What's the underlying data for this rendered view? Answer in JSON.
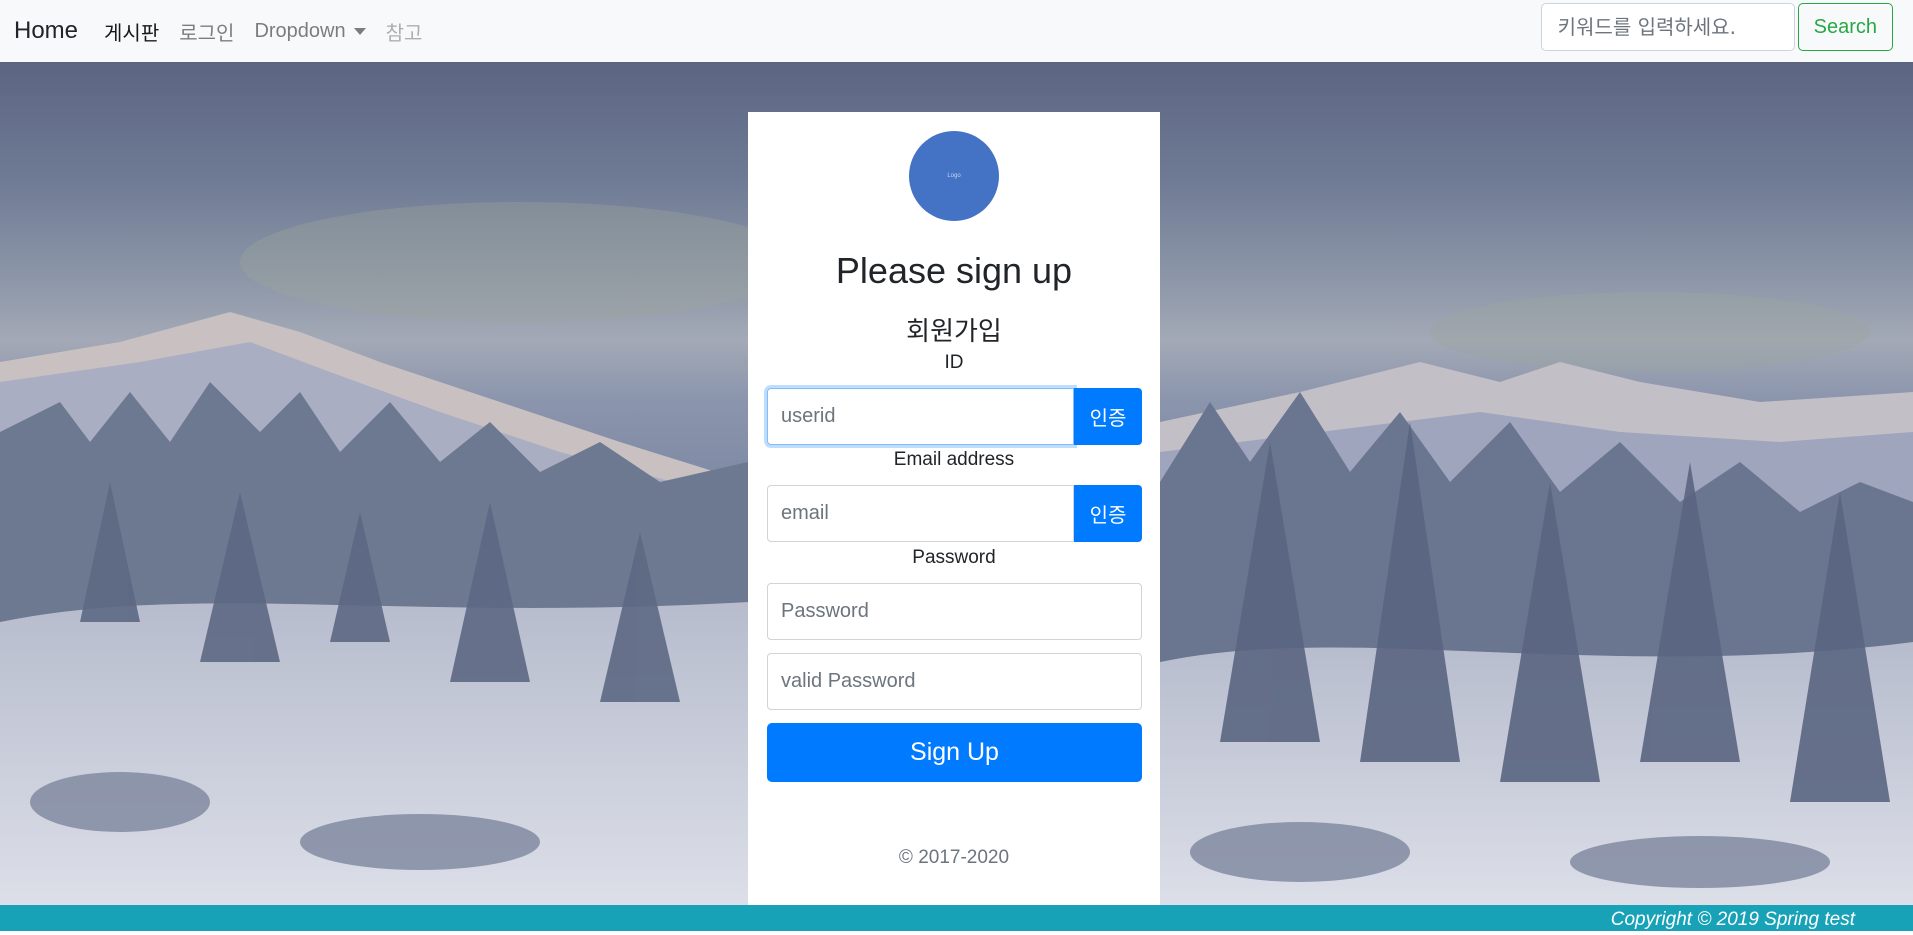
{
  "navbar": {
    "brand": "Home",
    "links": [
      {
        "label": "게시판"
      },
      {
        "label": "로그인"
      },
      {
        "label": "Dropdown"
      },
      {
        "label": "참고"
      }
    ],
    "search": {
      "placeholder": "키워드를 입력하세요.",
      "button_label": "Search"
    }
  },
  "form": {
    "logo_text": "Logo",
    "heading": "Please sign up",
    "subheading": "회원가입",
    "id_label": "ID",
    "id_placeholder": "userid",
    "verify_label": "인증",
    "email_label": "Email address",
    "email_placeholder": "email",
    "password_label": "Password",
    "password_placeholder": "Password",
    "password_confirm_placeholder": "valid Password",
    "submit_label": "Sign Up",
    "copyright": "© 2017-2020"
  },
  "footer": {
    "text": "Copyright © 2019 Spring test"
  },
  "colors": {
    "primary": "#007bff",
    "success": "#28a745",
    "footer": "#17a2b8",
    "logo": "#4472c4"
  }
}
